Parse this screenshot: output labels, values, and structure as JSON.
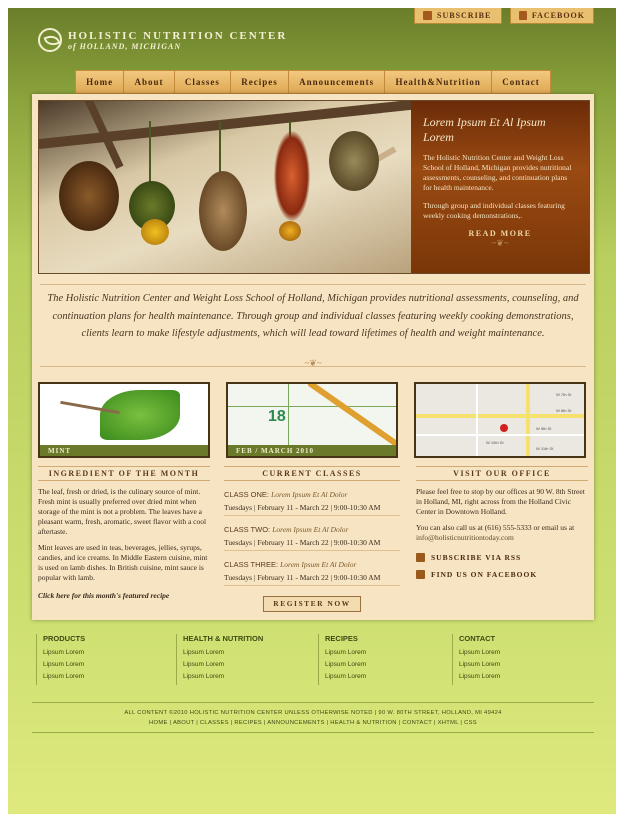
{
  "topbar": {
    "subscribe": "SUBSCRIBE",
    "facebook": "FACEBOOK"
  },
  "logo": {
    "title": "HOLISTIC NUTRITION CENTER",
    "subtitle": "of HOLLAND, MICHIGAN"
  },
  "nav": [
    "Home",
    "About",
    "Classes",
    "Recipes",
    "Announcements",
    "Health&Nutrition",
    "Contact"
  ],
  "hero": {
    "title": "Lorem Ipsum Et Al Ipsum Lorem",
    "text1": "The Holistic Nutrition Center and Weight Loss School of Holland, Michigan provides nutritional assessments, counseling, and continuation plans for health maintenance.",
    "text2": "Through group and individual classes featuring weekly cooking demonstrations,.",
    "read_more": "READ MORE"
  },
  "intro": "The Holistic Nutrition Center and Weight Loss School of Holland, Michigan provides nutritional assessments, counseling, and continuation plans for health maintenance.  Through group and individual classes featuring weekly cooking demonstrations, clients learn to make lifestyle adjustments, which will lead toward lifetimes of health and weight maintenance.",
  "cards": [
    {
      "caption": "MINT"
    },
    {
      "caption": "FEB / MARCH 2010",
      "calendar_number": "18"
    },
    {
      "caption": ""
    }
  ],
  "ingredient": {
    "heading": "INGREDIENT OF THE MONTH",
    "p1": "The leaf, fresh or dried, is the culinary source of mint. Fresh mint is usually preferred over dried mint when storage of the mint is not a problem. The leaves have a pleasant warm, fresh, aromatic, sweet flavor with a cool aftertaste.",
    "p2": "Mint leaves are used in teas, beverages, jellies, syrups, candies, and ice creams. In Middle Eastern cuisine, mint is used on lamb dishes. In British cuisine, mint sauce is popular with lamb.",
    "link": "Click here for this month's featured recipe"
  },
  "classes": {
    "heading": "CURRENT CLASSES",
    "items": [
      {
        "label": "CLASS ONE:",
        "name": "Lorem Ipsum Et Al Dolor",
        "time": "Tuesdays | February 11 - March 22 | 9:00-10:30 AM"
      },
      {
        "label": "CLASS TWO:",
        "name": "Lorem Ipsum Et Al Dolor",
        "time": "Tuesdays | February 11 - March 22 | 9:00-10:30 AM"
      },
      {
        "label": "CLASS THREE:",
        "name": "Lorem Ipsum Et Al Dolor",
        "time": "Tuesdays | February 11 - March 22 | 9:00-10:30 AM"
      }
    ],
    "register": "REGISTER NOW"
  },
  "office": {
    "heading": "VISIT OUR OFFICE",
    "p1": "Please feel free to stop by our offices at 90 W. 8th Street in Holland, MI, right across from the Holland Civic Center in Downtown Holland.",
    "p2": "You can also call us at (616) 555-5333 or email us at",
    "email": "info@holisticnutritiontoday.com",
    "rss": "SUBSCRIBE VIA RSS",
    "fb": "FIND US ON FACEBOOK",
    "map_streets": [
      "W 7th St",
      "W 8th St",
      "W 9th St",
      "W 10th St",
      "W 11th St"
    ]
  },
  "footer": {
    "columns": [
      {
        "title": "PRODUCTS",
        "items": [
          "Lipsum Lorem",
          "Lipsum Lorem",
          "Lipsum Lorem"
        ]
      },
      {
        "title": "HEALTH & NUTRITION",
        "items": [
          "Lipsum Lorem",
          "Lipsum Lorem",
          "Lipsum Lorem"
        ]
      },
      {
        "title": "RECIPES",
        "items": [
          "Lipsum Lorem",
          "Lipsum Lorem",
          "Lipsum Lorem"
        ]
      },
      {
        "title": "CONTACT",
        "items": [
          "Lipsum Lorem",
          "Lipsum Lorem",
          "Lipsum Lorem"
        ]
      }
    ],
    "copyright": "ALL CONTENT ©2010 HOLISTIC NUTRITION CENTER UNLESS OTHERWISE NOTED | 90 W. 80TH STREET, HOLLAND, MI 49424",
    "links": "HOME | ABOUT | CLASSES | RECIPES | ANNOUNCEMENTS | HEALTH & NUTRITION | CONTACT | XHTML | CSS"
  }
}
